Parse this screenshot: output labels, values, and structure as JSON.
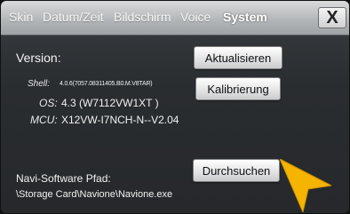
{
  "tabs": [
    {
      "label": "Skin"
    },
    {
      "label": "Datum/Zeit"
    },
    {
      "label": "Bildschirm"
    },
    {
      "label": "Voice"
    },
    {
      "label": "System"
    }
  ],
  "close_label": "X",
  "version_label": "Version:",
  "info": [
    {
      "key": "Shell:",
      "value": "4.0.6(7057.08311405.B0.M.V8TAR)"
    },
    {
      "key": "OS:",
      "value": "4.3 (W7112VW1XT   )"
    },
    {
      "key": "MCU:",
      "value": "X12VW-I7NCH-N--V2.04"
    }
  ],
  "buttons": {
    "update": "Aktualisieren",
    "calibrate": "Kalibrierung",
    "browse": "Durchsuchen"
  },
  "navi": {
    "label": "Navi-Software Pfad:",
    "path": "\\Storage Card\\Navione\\Navione.exe"
  },
  "colors": {
    "cursor": "#f5b400",
    "panel": "#2a2d30"
  },
  "icons": {
    "close": "close-icon",
    "pointer": "arrow-pointer-icon"
  }
}
